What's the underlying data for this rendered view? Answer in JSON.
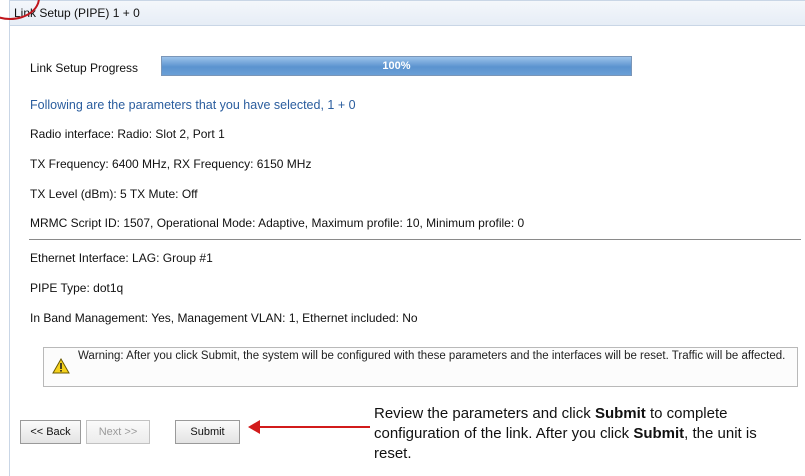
{
  "title": "Link Setup (PIPE) 1 + 0",
  "progress": {
    "label": "Link Setup Progress",
    "text": "100%",
    "value": 100
  },
  "params": {
    "heading": "Following are the parameters that you have selected, 1 + 0",
    "lines": [
      "Radio interface: Radio: Slot 2, Port 1",
      "TX Frequency: 6400 MHz, RX Frequency: 6150 MHz",
      "TX Level (dBm): 5 TX Mute: Off",
      "MRMC Script ID: 1507, Operational Mode: Adaptive, Maximum profile: 10, Minimum profile: 0"
    ],
    "lines2": [
      "Ethernet Interface: LAG: Group #1",
      "PIPE Type: dot1q",
      "In Band Management: Yes, Management VLAN: 1, Ethernet included: No"
    ]
  },
  "warning": {
    "text": "Warning: After you click Submit, the system will be configured with these parameters and the interfaces will be reset. Traffic will be affected.",
    "icon": "warning-icon"
  },
  "buttons": {
    "back": "<< Back",
    "next": "Next >>",
    "submit": "Submit"
  },
  "annotation": {
    "p1": "Review the parameters and click ",
    "b1": "Submit",
    "p2": " to complete configuration of the link. After you click ",
    "b2": "Submit",
    "p3": ", the unit is reset."
  },
  "colors": {
    "accent": "#2a5d9e",
    "progress": "#5b93cf",
    "arrow": "#d21b1b"
  }
}
